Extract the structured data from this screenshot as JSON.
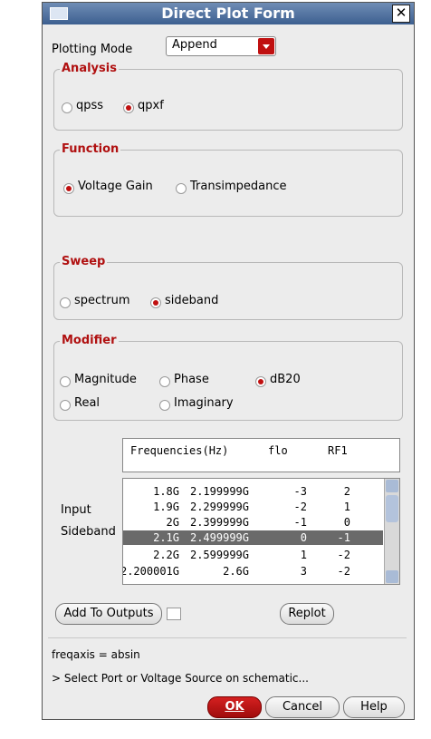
{
  "window": {
    "title": "Direct Plot Form"
  },
  "plotting_mode": {
    "label": "Plotting Mode",
    "value": "Append"
  },
  "analysis": {
    "title": "Analysis",
    "options": [
      "qpss",
      "qpxf"
    ],
    "selected": "qpxf"
  },
  "function": {
    "title": "Function",
    "options": [
      "Voltage Gain",
      "Transimpedance"
    ],
    "selected": "Voltage Gain"
  },
  "sweep": {
    "title": "Sweep",
    "options": [
      "spectrum",
      "sideband"
    ],
    "selected": "sideband"
  },
  "modifier": {
    "title": "Modifier",
    "options": [
      "Magnitude",
      "Phase",
      "dB20",
      "Real",
      "Imaginary"
    ],
    "selected": "dB20"
  },
  "sideband_table": {
    "label_line1": "Input",
    "label_line2": "Sideband",
    "header": [
      "Frequencies(Hz)",
      "flo",
      "RF1"
    ],
    "rows": [
      [
        "1.8G",
        "2.199999G",
        "-3",
        "2"
      ],
      [
        "1.9G",
        "2.299999G",
        "-2",
        "1"
      ],
      [
        "2G",
        "2.399999G",
        "-1",
        "0"
      ],
      [
        "2.1G",
        "2.499999G",
        "0",
        "-1"
      ],
      [
        "2.2G",
        "2.599999G",
        "1",
        "-2"
      ],
      [
        "2.200001G",
        "2.6G",
        "3",
        "-2"
      ]
    ],
    "selected_row": 3
  },
  "buttons": {
    "add_to_outputs": "Add To Outputs",
    "replot": "Replot",
    "ok": "OK",
    "cancel": "Cancel",
    "help": "Help"
  },
  "status": {
    "line1": "freqaxis = absin",
    "line2": "> Select Port or Voltage Source on schematic..."
  },
  "colors": {
    "accent": "#c01010",
    "title_bar": "#4a6a9a",
    "selected_row": "#6a6a6a"
  }
}
